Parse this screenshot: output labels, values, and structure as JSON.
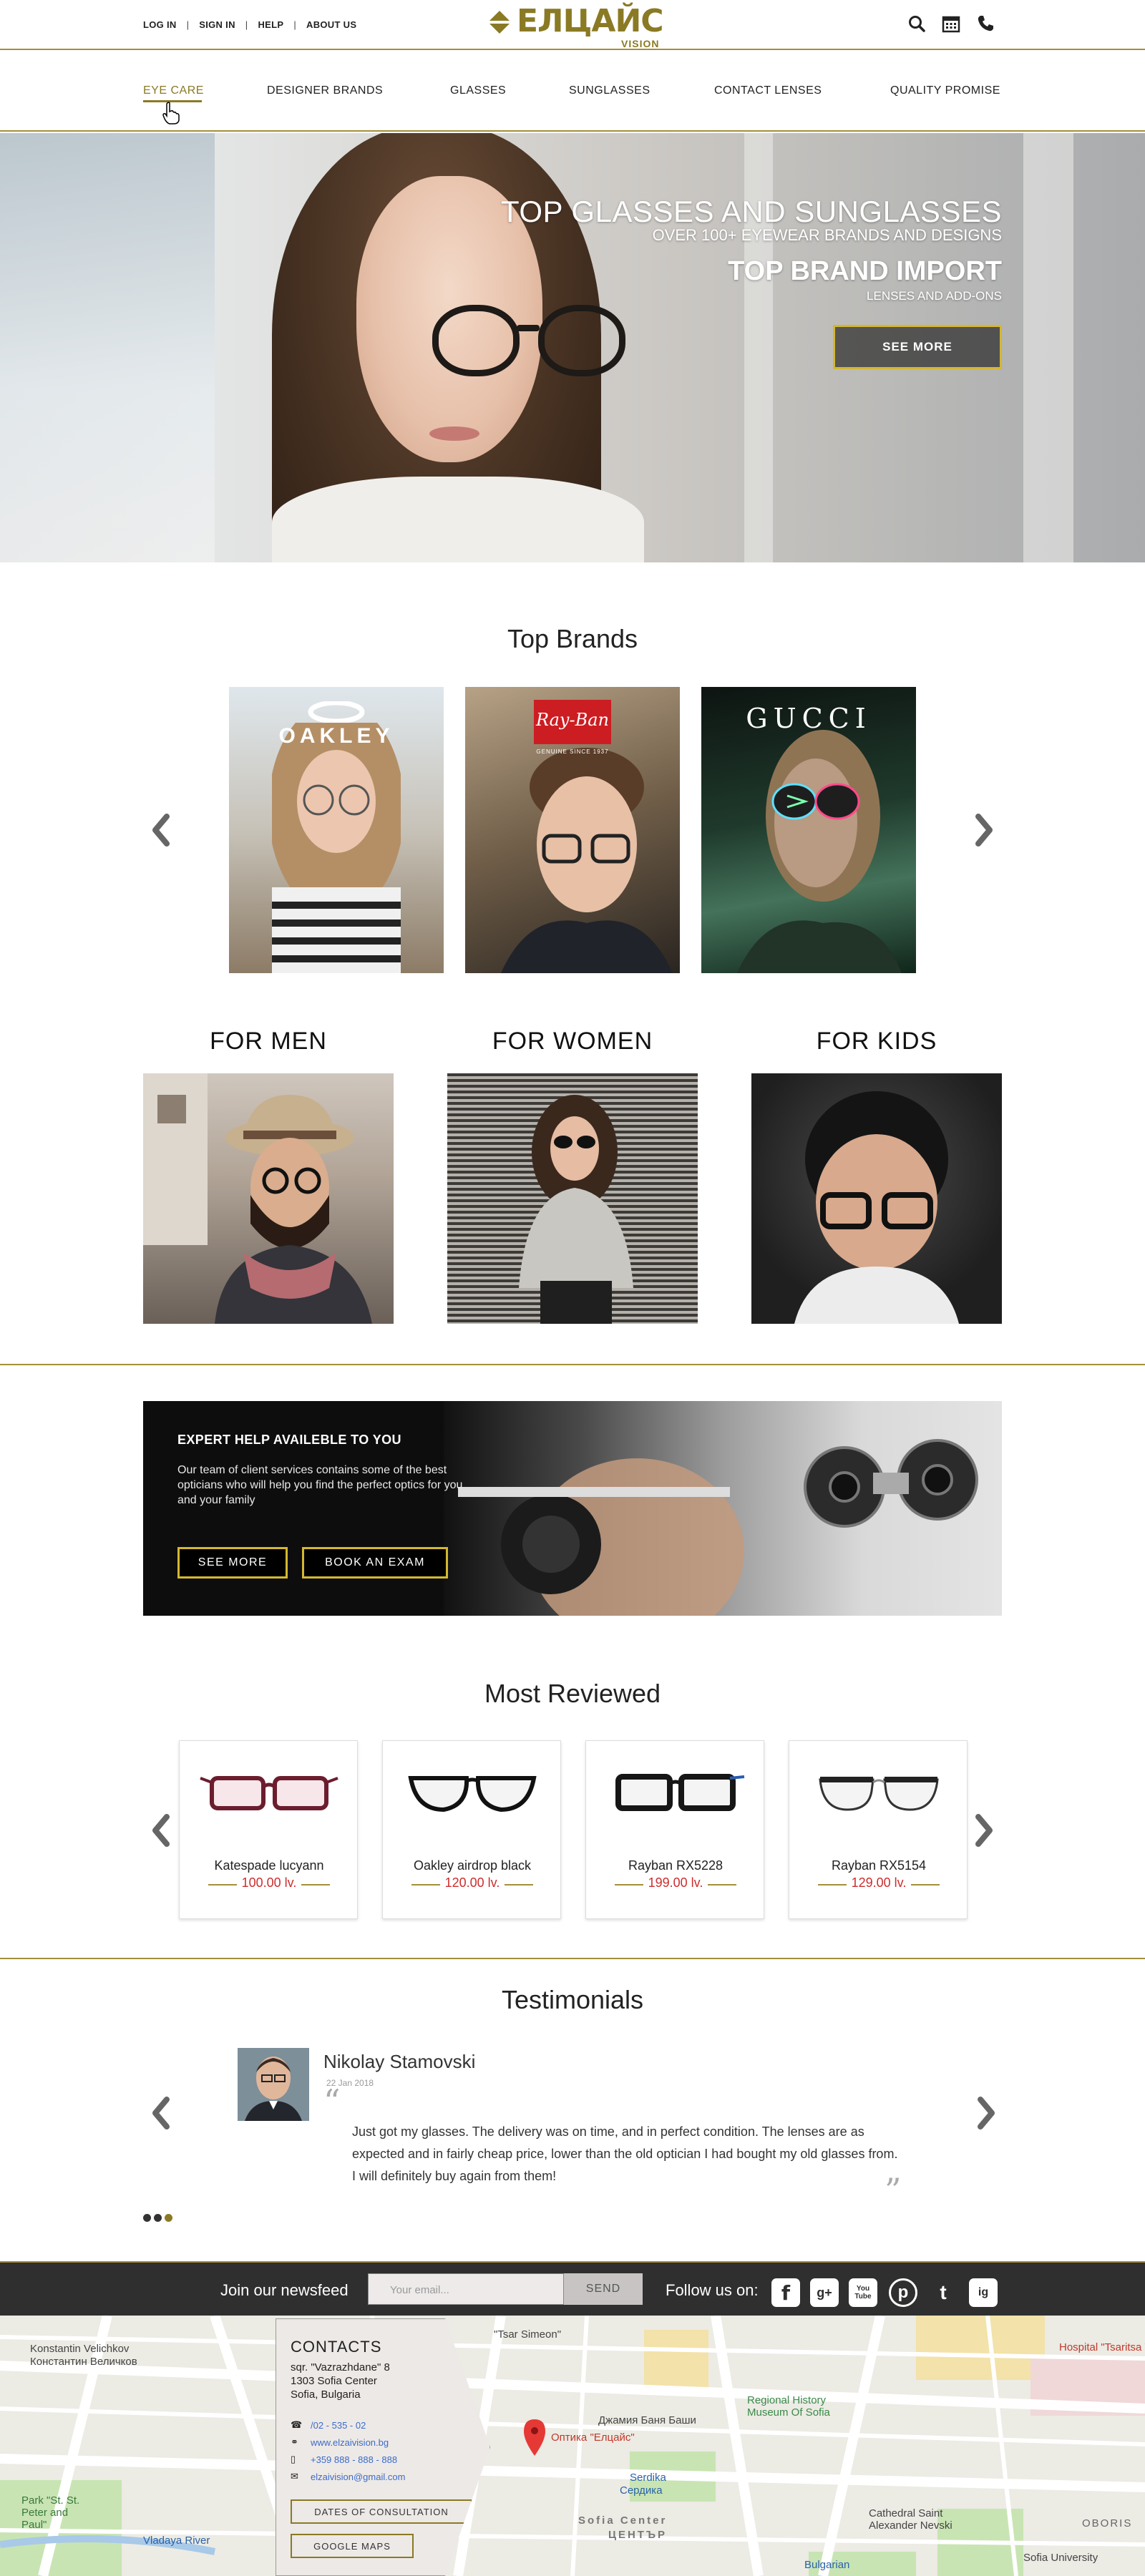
{
  "header": {
    "top_links": [
      "LOG IN",
      "SIGN IN",
      "HELP",
      "ABOUT US"
    ],
    "logo_text": "ЕЛЦАЙС",
    "logo_sub": "VISION",
    "icons": [
      "search-icon",
      "calendar-icon",
      "phone-icon"
    ]
  },
  "nav": {
    "items": [
      "EYE CARE",
      "DESIGNER BRANDS",
      "GLASSES",
      "SUNGLASSES",
      "CONTACT LENSES",
      "QUALITY PROMISE"
    ],
    "active": "EYE CARE"
  },
  "hero": {
    "title": "TOP GLASSES AND SUNGLASSES",
    "subtitle": "OVER 100+ EYEWEAR BRANDS AND DESIGNS",
    "title2": "TOP BRAND IMPORT",
    "subtitle2": "LENSES AND ADD-ONS",
    "button": "SEE MORE"
  },
  "brands": {
    "title": "Top Brands",
    "items": [
      {
        "name": "OAKLEY"
      },
      {
        "name": "Ray-Ban",
        "tag": "GENUINE SINCE 1937"
      },
      {
        "name": "GUCCI"
      }
    ]
  },
  "categories": [
    "FOR MEN",
    "FOR WOMEN",
    "FOR KIDS"
  ],
  "expert": {
    "title": "EXPERT HELP AVAILEBLE TO YOU",
    "text": "Our team of client services contains some of the best opticians who will help you find the perfect optics for you and your family",
    "button1": "SEE MORE",
    "button2": "BOOK AN EXAM"
  },
  "reviewed": {
    "title": "Most Reviewed",
    "products": [
      {
        "name": "Katespade lucyann",
        "price": "100.00 lv."
      },
      {
        "name": "Oakley airdrop black",
        "price": "120.00 lv."
      },
      {
        "name": "Rayban RX5228",
        "price": "199.00 lv."
      },
      {
        "name": "Rayban RX5154",
        "price": "129.00 lv."
      }
    ]
  },
  "testimonials": {
    "title": "Testimonials",
    "name": "Nikolay Stamovski",
    "date": "22 Jan 2018",
    "text": "Just got my glasses. The delivery was on time, and in perfect condition. The lenses are as expected and in fairly cheap price, lower than the old optician I had bought my old glasses from. I will definitely buy again from them!",
    "dots": 3,
    "active_dot": 3
  },
  "newsletter": {
    "label": "Join our newsfeed",
    "placeholder": "Your email...",
    "send": "SEND",
    "follow": "Follow us on:",
    "social": [
      "f",
      "g+",
      "You Tube",
      "p",
      "t",
      "ig"
    ]
  },
  "contacts": {
    "title": "CONTACTS",
    "address": [
      "sqr. \"Vazrazhdane\" 8",
      "1303 Sofia Center",
      "Sofia, Bulgaria"
    ],
    "phone": "/02 - 535 - 02",
    "web": "www.elzaivision.bg",
    "mobile": "+359 888 - 888 - 888",
    "email": "elzaivision@gmail.com",
    "btn_dates": "DATES OF CONSULTATION",
    "btn_maps": "GOOGLE MAPS"
  },
  "map": {
    "labels": [
      "Konstantin Velichkov",
      "Константин Величков",
      "\"Tsar Simeon\"",
      "Regional History Museum Of Sofia",
      "Sofia Center",
      "ЦЕНТЪР",
      "Cathedral Saint Alexander Nevski",
      "Hospital \"Tsaritsa Yoanna\"",
      "Оптика \"Елцайс\"",
      "Serdika",
      "Сердика",
      "Park \"St. St. Peter and Paul\"",
      "Vladaya River",
      "Джамия Баня Баши",
      "OBORIS",
      "Sofia University",
      "Bulgarian"
    ]
  },
  "colors": {
    "accent": "#a48f3a",
    "price": "#cc2d2d",
    "footer": "#2f2f2f"
  }
}
